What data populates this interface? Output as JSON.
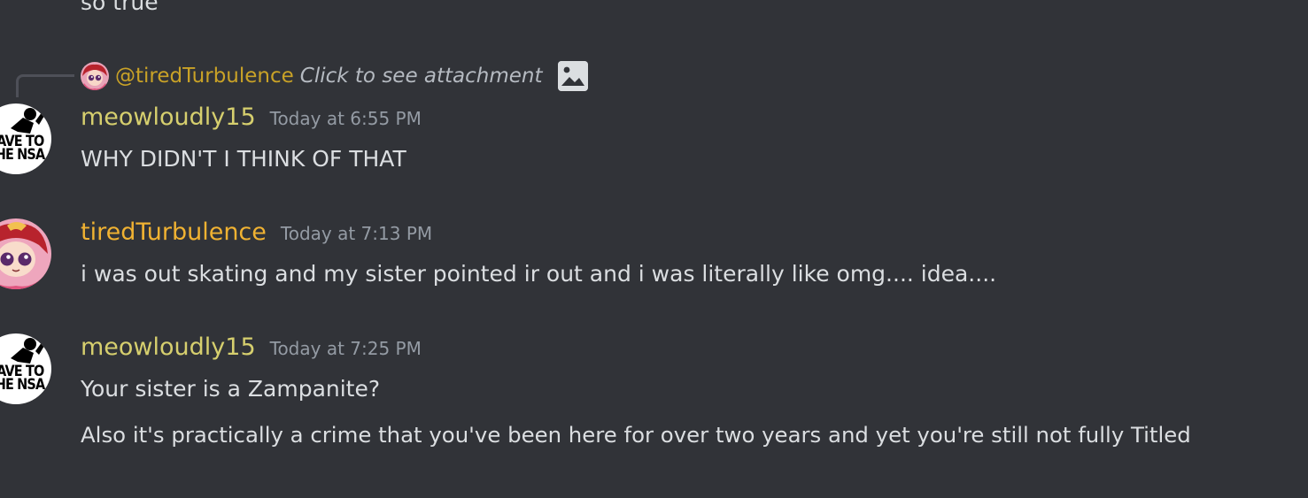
{
  "previous_message": {
    "text": "so true"
  },
  "reply": {
    "username": "@tiredTurbulence",
    "attachment_text": "Click to see attachment",
    "icon": "image-icon"
  },
  "messages": [
    {
      "username": "meowloudly15",
      "timestamp": "Today at 6:55 PM",
      "lines": [
        "WHY DIDN'T I THINK OF THAT"
      ],
      "avatar_text": "SAVE TO THE NSA"
    },
    {
      "username": "tiredTurbulence",
      "timestamp": "Today at 7:13 PM",
      "lines": [
        "i was out skating and my sister pointed ir out and i was literally like omg.... idea...."
      ]
    },
    {
      "username": "meowloudly15",
      "timestamp": "Today at 7:25 PM",
      "lines": [
        "Your sister is a Zampanite?",
        "Also it's practically a crime that you've been here for over two years and yet you're still not fully Titled"
      ],
      "avatar_text": "SAVE TO THE NSA"
    }
  ],
  "colors": {
    "background": "#313338",
    "text": "#dbdee1",
    "username_meowloudly15": "#d6cf6e",
    "username_tiredTurbulence": "#f0b232",
    "timestamp": "#949ba4"
  }
}
